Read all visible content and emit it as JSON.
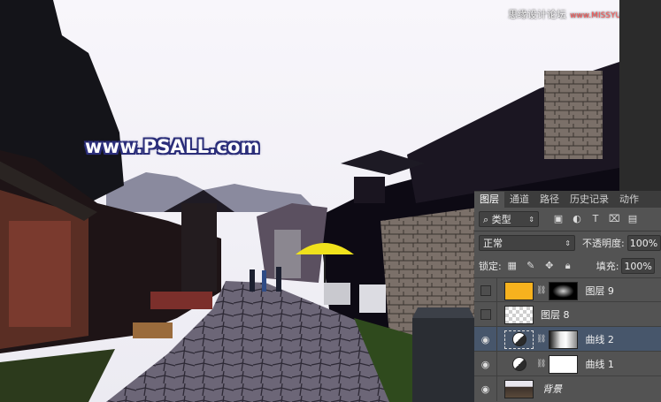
{
  "watermark": {
    "text": "思缘设计论坛",
    "site": "www.MISSYUAN.COM"
  },
  "overlay_logo": "www.PSALL.com",
  "layers_panel": {
    "tabs": [
      "图层",
      "通道",
      "路径",
      "历史记录",
      "动作"
    ],
    "active_tab": "图层",
    "filter": {
      "label": "类型"
    },
    "blend_mode": "正常",
    "opacity_label": "不透明度:",
    "opacity_value": "100%",
    "lock_label": "锁定:",
    "fill_label": "填充:",
    "fill_value": "100%",
    "layers": [
      {
        "name": "图层 9",
        "visible": false,
        "thumb_color": "#f7b21e",
        "has_mask": true
      },
      {
        "name": "图层 8",
        "visible": false,
        "thumb_color": "transparent",
        "has_mask": false
      },
      {
        "name": "曲线 2",
        "visible": true,
        "adjustment": true,
        "selected": true,
        "has_mask": true
      },
      {
        "name": "曲线 1",
        "visible": true,
        "adjustment": true,
        "has_mask": true
      },
      {
        "name": "背景",
        "visible": true,
        "italic": true
      }
    ]
  },
  "colors": {
    "panel_bg": "#535353",
    "selected_layer": "#47566b",
    "accent_yellow": "#f7b21e"
  }
}
